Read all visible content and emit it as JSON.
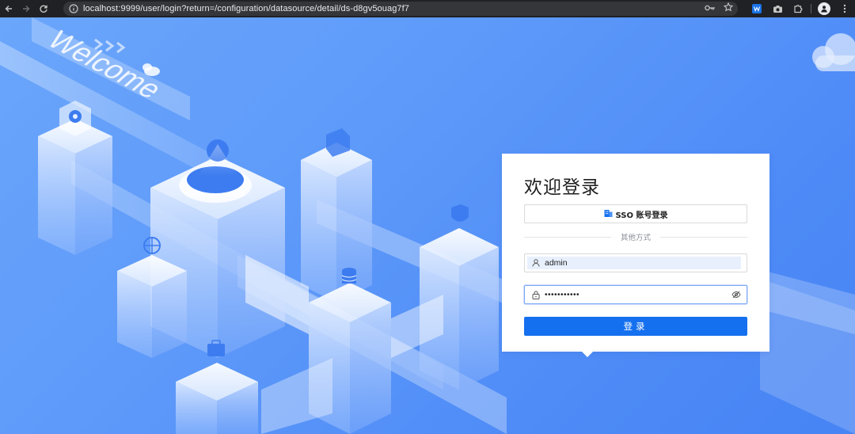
{
  "browser": {
    "url": "localhost:9999/user/login?return=/configuration/datasource/detail/ds-d8gv5ouag7f7",
    "icons": [
      "back-icon",
      "forward-icon",
      "reload-icon",
      "site-info-icon",
      "password-key-icon",
      "bookmark-star-icon",
      "extension-w-icon",
      "camera-icon",
      "extensions-puzzle-icon",
      "profile-icon",
      "menu-dots-icon"
    ]
  },
  "illustration": {
    "welcome_text": "Welcome"
  },
  "login": {
    "title": "欢迎登录",
    "sso_button": "SSO 账号登录",
    "divider_text": "其他方式",
    "username_value": "admin",
    "password_masked": "•••••••••••",
    "submit_label": "登录"
  },
  "colors": {
    "primary": "#1570ef",
    "background": "#5f9bfa",
    "card": "#ffffff"
  }
}
